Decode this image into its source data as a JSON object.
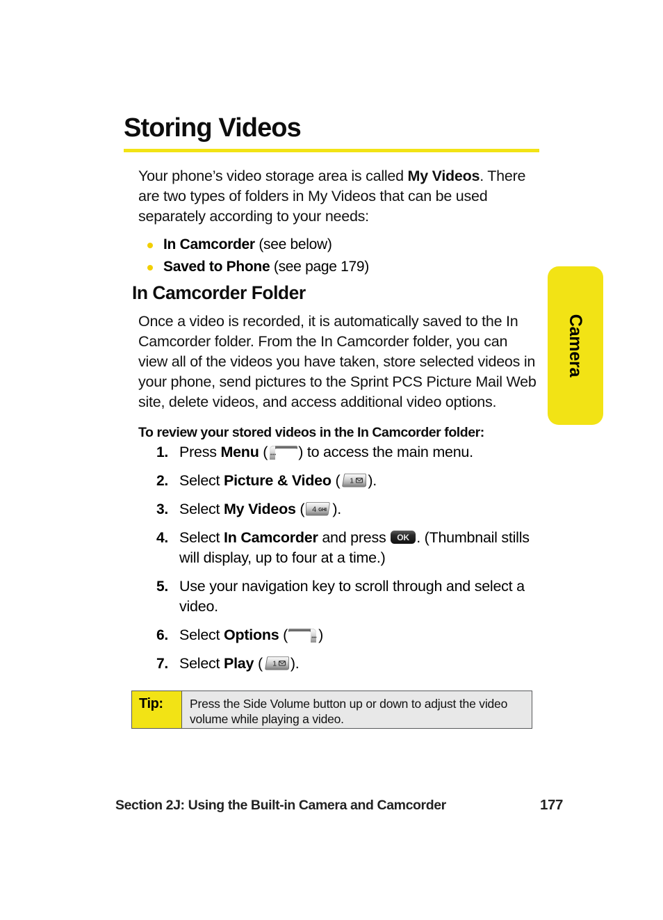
{
  "page": {
    "heading": "Storing Videos",
    "accent_color": "#f2e315",
    "bullet_color": "#f2cf00"
  },
  "side_tab": {
    "label": "Camera"
  },
  "intro": {
    "part1": "Your phone’s video storage area is called ",
    "bold1": "My Videos",
    "part2": ". There are two types of folders in My Videos that can be used separately according to your needs:"
  },
  "bullets": [
    {
      "bold": "In Camcorder",
      "rest": " (see below)"
    },
    {
      "bold": "Saved to Phone",
      "rest": " (see page 179)"
    }
  ],
  "section": {
    "heading": "In Camcorder Folder",
    "paragraph": "Once a video is recorded, it is automatically saved to the In Camcorder folder. From the In Camcorder folder, you can view all of the videos you have taken, store selected videos in your phone, send pictures to the Sprint PCS Picture Mail Web site, delete videos, and access additional video options.",
    "lead_in": "To review your stored videos in the In Camcorder folder:"
  },
  "steps": [
    {
      "num": "1.",
      "pre": "Press ",
      "bold": "Menu",
      "mid": " (",
      "icon": "left-softkey-icon",
      "post": ") to access the main menu."
    },
    {
      "num": "2.",
      "pre": "Select ",
      "bold": "Picture & Video",
      "mid": " (",
      "icon": "key-1-icon",
      "post": ")."
    },
    {
      "num": "3.",
      "pre": "Select ",
      "bold": "My Videos",
      "mid": " (",
      "icon": "key-4-ghi-icon",
      "post": ")."
    },
    {
      "num": "4.",
      "pre": "Select ",
      "bold": "In Camcorder",
      "mid": " and press ",
      "icon": "ok-key-icon",
      "post": ". (Thumbnail stills will display, up to four at a time.)"
    },
    {
      "num": "5.",
      "pre": "Use your navigation key to scroll through and select a video.",
      "bold": "",
      "mid": "",
      "icon": "",
      "post": ""
    },
    {
      "num": "6.",
      "pre": "Select ",
      "bold": "Options",
      "mid": " (",
      "icon": "right-softkey-icon",
      "post": ")"
    },
    {
      "num": "7.",
      "pre": "Select ",
      "bold": "Play",
      "mid": " (",
      "icon": "key-1-icon",
      "post": ")."
    }
  ],
  "key_glyphs": {
    "key_1_digit": "1",
    "key_1_symbol": "envelope-icon",
    "key_4_digit": "4",
    "key_4_letters": "GHI",
    "ok_label": "OK",
    "softkey_dots": "···"
  },
  "tip": {
    "label": "Tip:",
    "text": "Press the Side Volume button up or down to adjust the video volume while playing a video."
  },
  "footer": {
    "section_title": "Section 2J: Using the Built-in Camera and Camcorder",
    "page_number": "177"
  }
}
